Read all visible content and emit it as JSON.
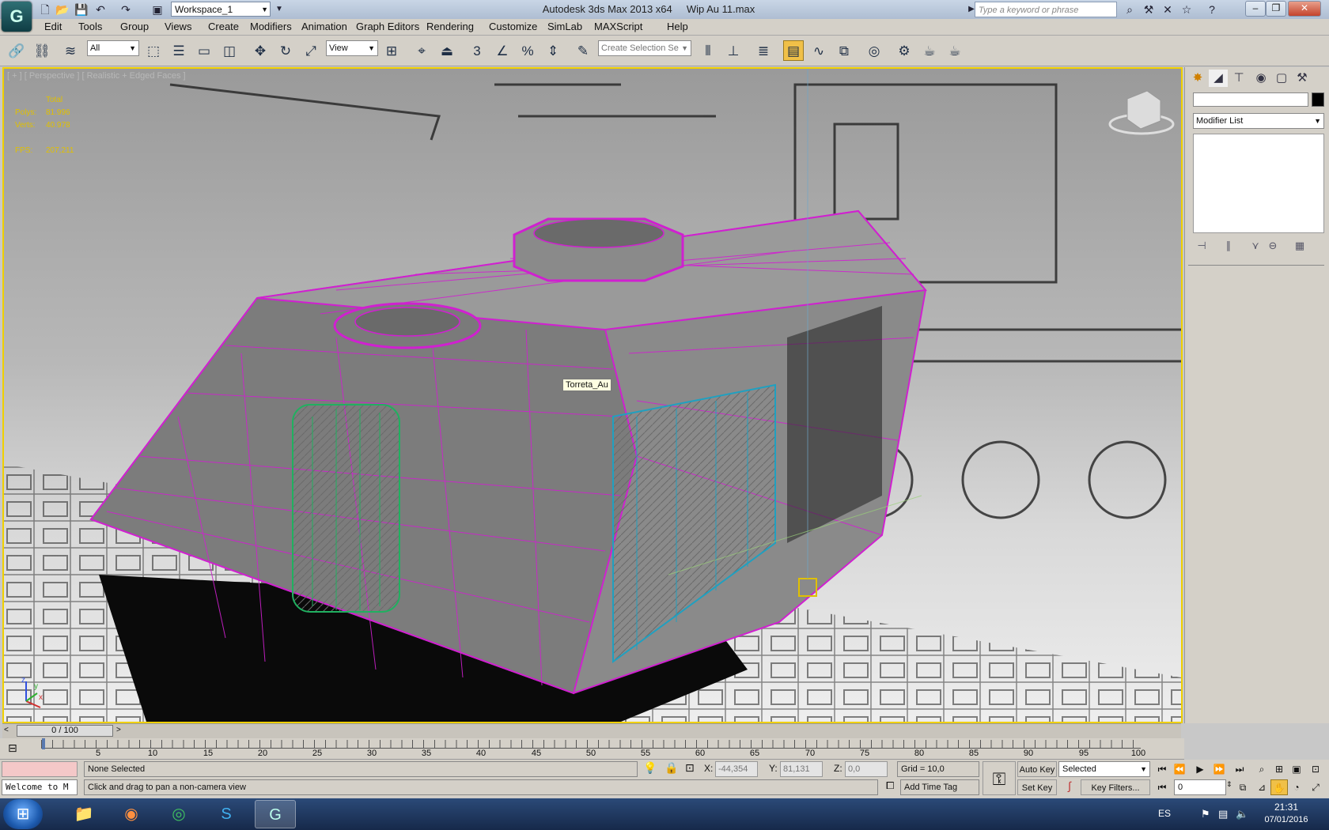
{
  "titlebar": {
    "workspace": "Workspace_1",
    "app_title": "Autodesk 3ds Max  2013 x64",
    "file_title": "Wip Au 11.max",
    "search_placeholder": "Type a keyword or phrase"
  },
  "menu": [
    "Edit",
    "Tools",
    "Group",
    "Views",
    "Create",
    "Modifiers",
    "Animation",
    "Graph Editors",
    "Rendering",
    "Customize",
    "SimLab",
    "MAXScript",
    "Help"
  ],
  "toolbar": {
    "selection_filter": "All",
    "reference_coord": "View",
    "named_selection": "Create Selection Se"
  },
  "viewport": {
    "label": "[ + ] [ Perspective ] [ Realistic + Edged Faces ]",
    "stats": {
      "header": "Total",
      "polys_label": "Polys:",
      "polys_value": "81.996",
      "verts_label": "Verts:",
      "verts_value": "40.978",
      "fps_label": "FPS:",
      "fps_value": "207,211"
    },
    "object_tooltip": "Torreta_Au",
    "axis": {
      "x": "x",
      "y": "y",
      "z": "z"
    },
    "colors": {
      "wireframe": "#d020d0",
      "hatch_green": "#20b060",
      "hatch_cyan": "#20a0c0",
      "active_border": "#f0d000"
    }
  },
  "command_panel": {
    "modifier_list": "Modifier List"
  },
  "timeline": {
    "frame_counter": "0 / 100",
    "ticks": [
      "5",
      "10",
      "15",
      "20",
      "25",
      "30",
      "35",
      "40",
      "45",
      "50",
      "55",
      "60",
      "65",
      "70",
      "75",
      "80",
      "85",
      "90",
      "95",
      "100"
    ]
  },
  "status": {
    "maxscript_listener": "Welcome to M",
    "selection_status": "None Selected",
    "prompt": "Click and drag to pan a non-camera view",
    "x_label": "X:",
    "x_value": "-44,354",
    "y_label": "Y:",
    "y_value": "81,131",
    "z_label": "Z:",
    "z_value": "0,0",
    "grid": "Grid = 10,0",
    "add_time_tag": "Add Time Tag",
    "auto_key": "Auto Key",
    "set_key": "Set Key",
    "key_mode": "Selected",
    "key_filters": "Key Filters...",
    "current_frame": "0"
  },
  "taskbar": {
    "language": "ES",
    "time": "21:31",
    "date": "07/01/2016"
  }
}
